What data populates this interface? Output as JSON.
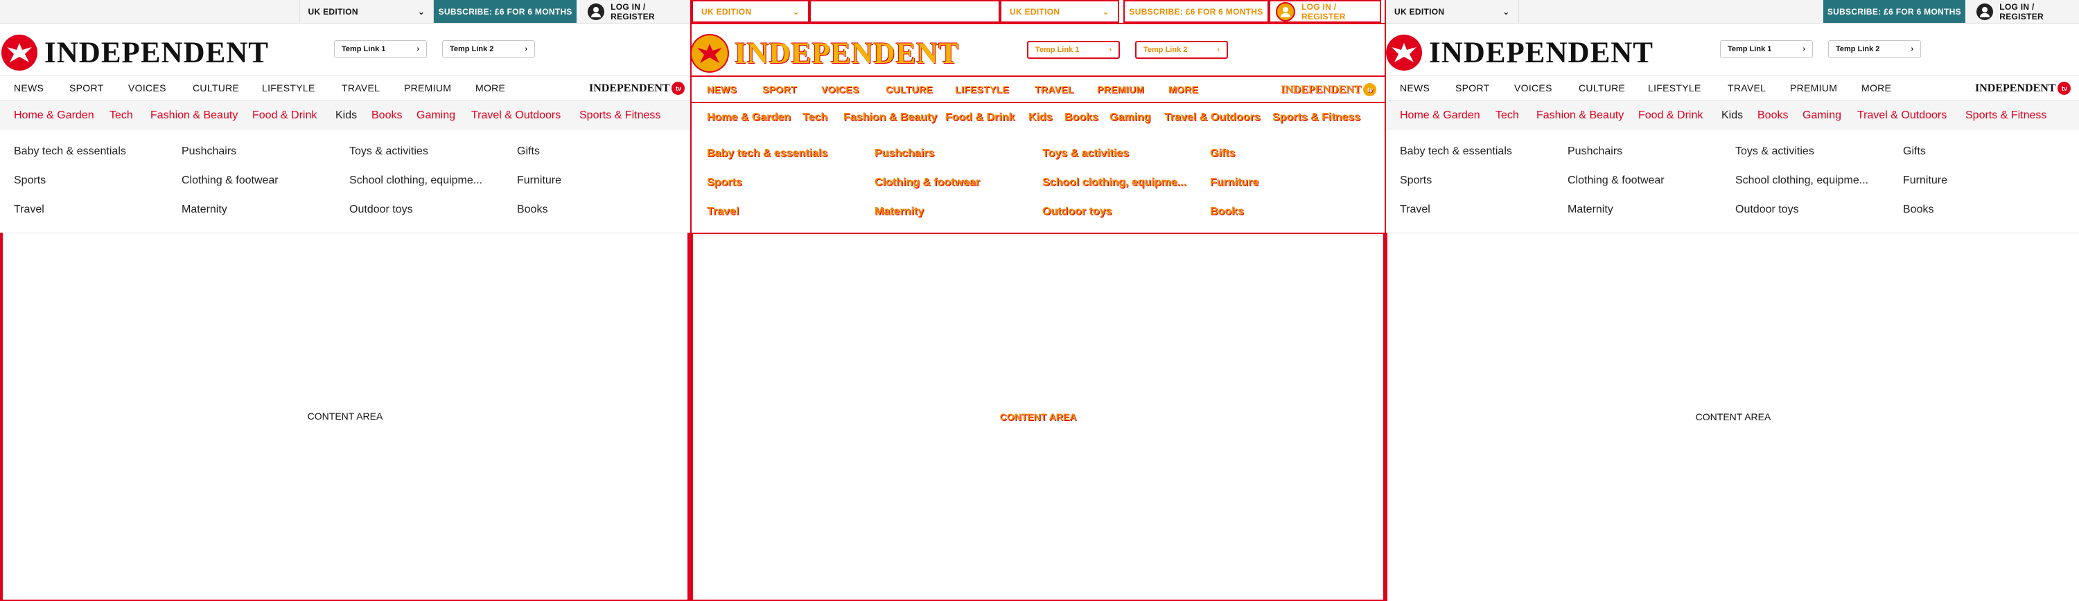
{
  "header": {
    "edition_label": "UK EDITION",
    "subscribe_label": "SUBSCRIBE: £6 FOR 6 MONTHS",
    "login_label": "LOG IN / REGISTER"
  },
  "logo": {
    "wordmark": "INDEPENDENT",
    "tv_wordmark": "INDEPENDENT",
    "tv_badge": "tv"
  },
  "temp_links": [
    "Temp Link 1",
    "Temp Link 2"
  ],
  "nav": [
    "NEWS",
    "SPORT",
    "VOICES",
    "CULTURE",
    "LIFESTYLE",
    "TRAVEL",
    "PREMIUM",
    "MORE"
  ],
  "categories": [
    "Home & Garden",
    "Tech",
    "Fashion & Beauty",
    "Food & Drink",
    "Kids",
    "Books",
    "Gaming",
    "Travel & Outdoors",
    "Sports & Fitness"
  ],
  "subcategories": [
    [
      "Baby tech & essentials",
      "Sports",
      "Travel"
    ],
    [
      "Pushchairs",
      "Clothing & footwear",
      "Maternity"
    ],
    [
      "Toys & activities",
      "School clothing, equipme...",
      "Outdoor toys"
    ],
    [
      "Gifts",
      "Furniture",
      "Books"
    ]
  ],
  "content_label": "CONTENT AREA",
  "colors": {
    "brand_red": "#e0001b",
    "subscribe_teal": "#26757e",
    "debug_orange": "#f08c00"
  }
}
